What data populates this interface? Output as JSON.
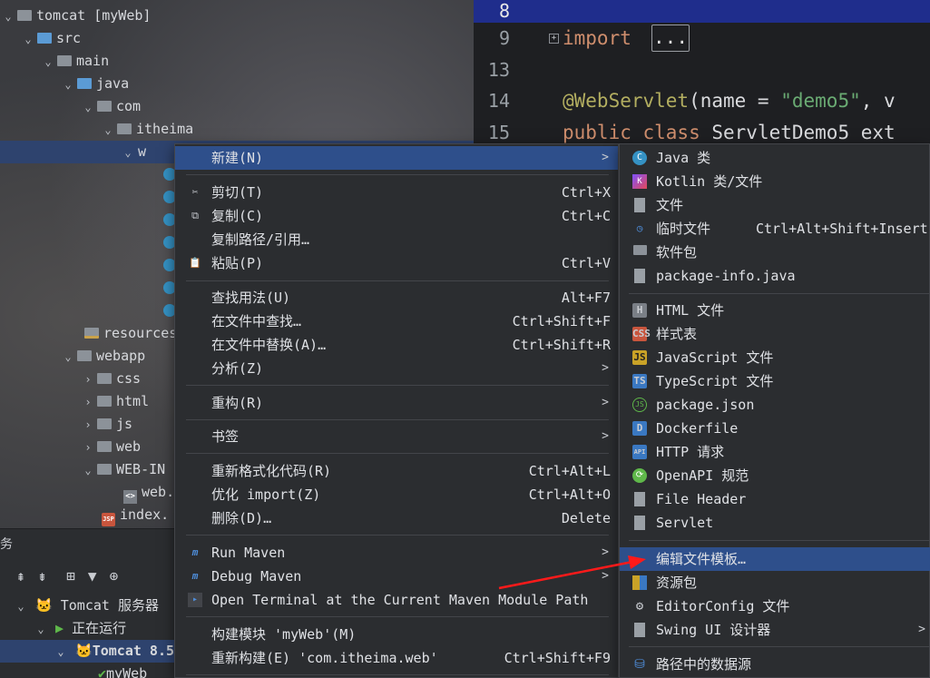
{
  "tree": {
    "items": [
      {
        "label": "tomcat [myWeb]"
      },
      {
        "label": "src"
      },
      {
        "label": "main"
      },
      {
        "label": "java"
      },
      {
        "label": "com"
      },
      {
        "label": "itheima"
      },
      {
        "label": "w"
      },
      {
        "label": "resources"
      },
      {
        "label": "webapp"
      },
      {
        "label": "css"
      },
      {
        "label": "html"
      },
      {
        "label": "js"
      },
      {
        "label": "web"
      },
      {
        "label": "WEB-IN"
      },
      {
        "label": "web."
      },
      {
        "label": "index."
      }
    ]
  },
  "editor": {
    "lines": [
      {
        "num": "8"
      },
      {
        "num": "9",
        "kw": "import",
        "fold": "..."
      },
      {
        "num": "13"
      },
      {
        "num": "14",
        "ann": "@WebServlet",
        "rest1": "(name = ",
        "str": "\"demo5\"",
        "rest2": ", v"
      },
      {
        "num": "15",
        "kw": "public class ",
        "rest": "ServletDemo5 ext"
      }
    ]
  },
  "services": {
    "title": "务",
    "server": "Tomcat 服务器",
    "running": "正在运行",
    "instance": "Tomcat 8.5",
    "artifact": "myWeb"
  },
  "context_menu": {
    "items": [
      {
        "label": "新建(N)"
      },
      {
        "label": "剪切(T)",
        "shortcut": "Ctrl+X"
      },
      {
        "label": "复制(C)",
        "shortcut": "Ctrl+C"
      },
      {
        "label": "复制路径/引用…"
      },
      {
        "label": "粘贴(P)",
        "shortcut": "Ctrl+V"
      },
      {
        "label": "查找用法(U)",
        "shortcut": "Alt+F7"
      },
      {
        "label": "在文件中查找…",
        "shortcut": "Ctrl+Shift+F"
      },
      {
        "label": "在文件中替换(A)…",
        "shortcut": "Ctrl+Shift+R"
      },
      {
        "label": "分析(Z)"
      },
      {
        "label": "重构(R)"
      },
      {
        "label": "书签"
      },
      {
        "label": "重新格式化代码(R)",
        "shortcut": "Ctrl+Alt+L"
      },
      {
        "label": "优化 import(Z)",
        "shortcut": "Ctrl+Alt+O"
      },
      {
        "label": "删除(D)…",
        "shortcut": "Delete"
      },
      {
        "label": "Run Maven"
      },
      {
        "label": "Debug Maven"
      },
      {
        "label": "Open Terminal at the Current Maven Module Path"
      },
      {
        "label": "构建模块 'myWeb'(M)"
      },
      {
        "label": "重新构建(E) 'com.itheima.web'",
        "shortcut": "Ctrl+Shift+F9"
      }
    ]
  },
  "new_submenu": {
    "items": [
      {
        "label": "Java 类"
      },
      {
        "label": "Kotlin 类/文件"
      },
      {
        "label": "文件"
      },
      {
        "label": "临时文件",
        "shortcut": "Ctrl+Alt+Shift+Insert"
      },
      {
        "label": "软件包"
      },
      {
        "label": "package-info.java"
      },
      {
        "label": "HTML 文件"
      },
      {
        "label": "样式表"
      },
      {
        "label": "JavaScript 文件"
      },
      {
        "label": "TypeScript 文件"
      },
      {
        "label": "package.json"
      },
      {
        "label": "Dockerfile"
      },
      {
        "label": "HTTP 请求"
      },
      {
        "label": "OpenAPI 规范"
      },
      {
        "label": "File Header"
      },
      {
        "label": "Servlet"
      },
      {
        "label": "编辑文件模板…"
      },
      {
        "label": "资源包"
      },
      {
        "label": "EditorConfig 文件"
      },
      {
        "label": "Swing UI 设计器"
      },
      {
        "label": "路径中的数据源"
      }
    ]
  },
  "colors": {
    "highlight": "#2e4f8b",
    "arrow": "#ff1a1a"
  }
}
